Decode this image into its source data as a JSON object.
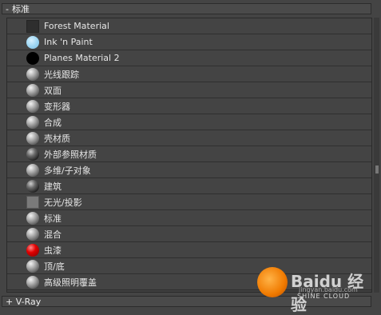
{
  "rollout": {
    "sign": "-",
    "title": "标准"
  },
  "materials": [
    {
      "label": "Forest Material",
      "icon": "dark-square-swatch"
    },
    {
      "label": "Ink 'n Paint",
      "icon": "light-blue-sphere"
    },
    {
      "label": "Planes Material 2",
      "icon": "black-sphere"
    },
    {
      "label": "光线跟踪",
      "icon": "gray-sphere"
    },
    {
      "label": "双面",
      "icon": "gray-sphere"
    },
    {
      "label": "变形器",
      "icon": "gray-sphere"
    },
    {
      "label": "合成",
      "icon": "gray-sphere"
    },
    {
      "label": "壳材质",
      "icon": "gray-sphere"
    },
    {
      "label": "外部参照材质",
      "icon": "dark-sphere"
    },
    {
      "label": "多维/子对象",
      "icon": "gray-sphere"
    },
    {
      "label": "建筑",
      "icon": "dark-sphere"
    },
    {
      "label": "无光/投影",
      "icon": "gray-square-swatch"
    },
    {
      "label": "标准",
      "icon": "gray-sphere"
    },
    {
      "label": "混合",
      "icon": "gray-sphere"
    },
    {
      "label": "虫漆",
      "icon": "red-sphere"
    },
    {
      "label": "顶/底",
      "icon": "gray-sphere"
    },
    {
      "label": "高级照明覆盖",
      "icon": "gray-sphere"
    }
  ],
  "bottom_rollout": {
    "label": "+ V-Ray"
  },
  "watermark": {
    "brand": "Baidu 经验",
    "url": "jingyan.baidu.com",
    "sub": "SHINE CLOUD"
  },
  "colors": {
    "panel_bg": "#444444",
    "row_border": "#2f2f2f",
    "text": "#e6e6e6"
  }
}
